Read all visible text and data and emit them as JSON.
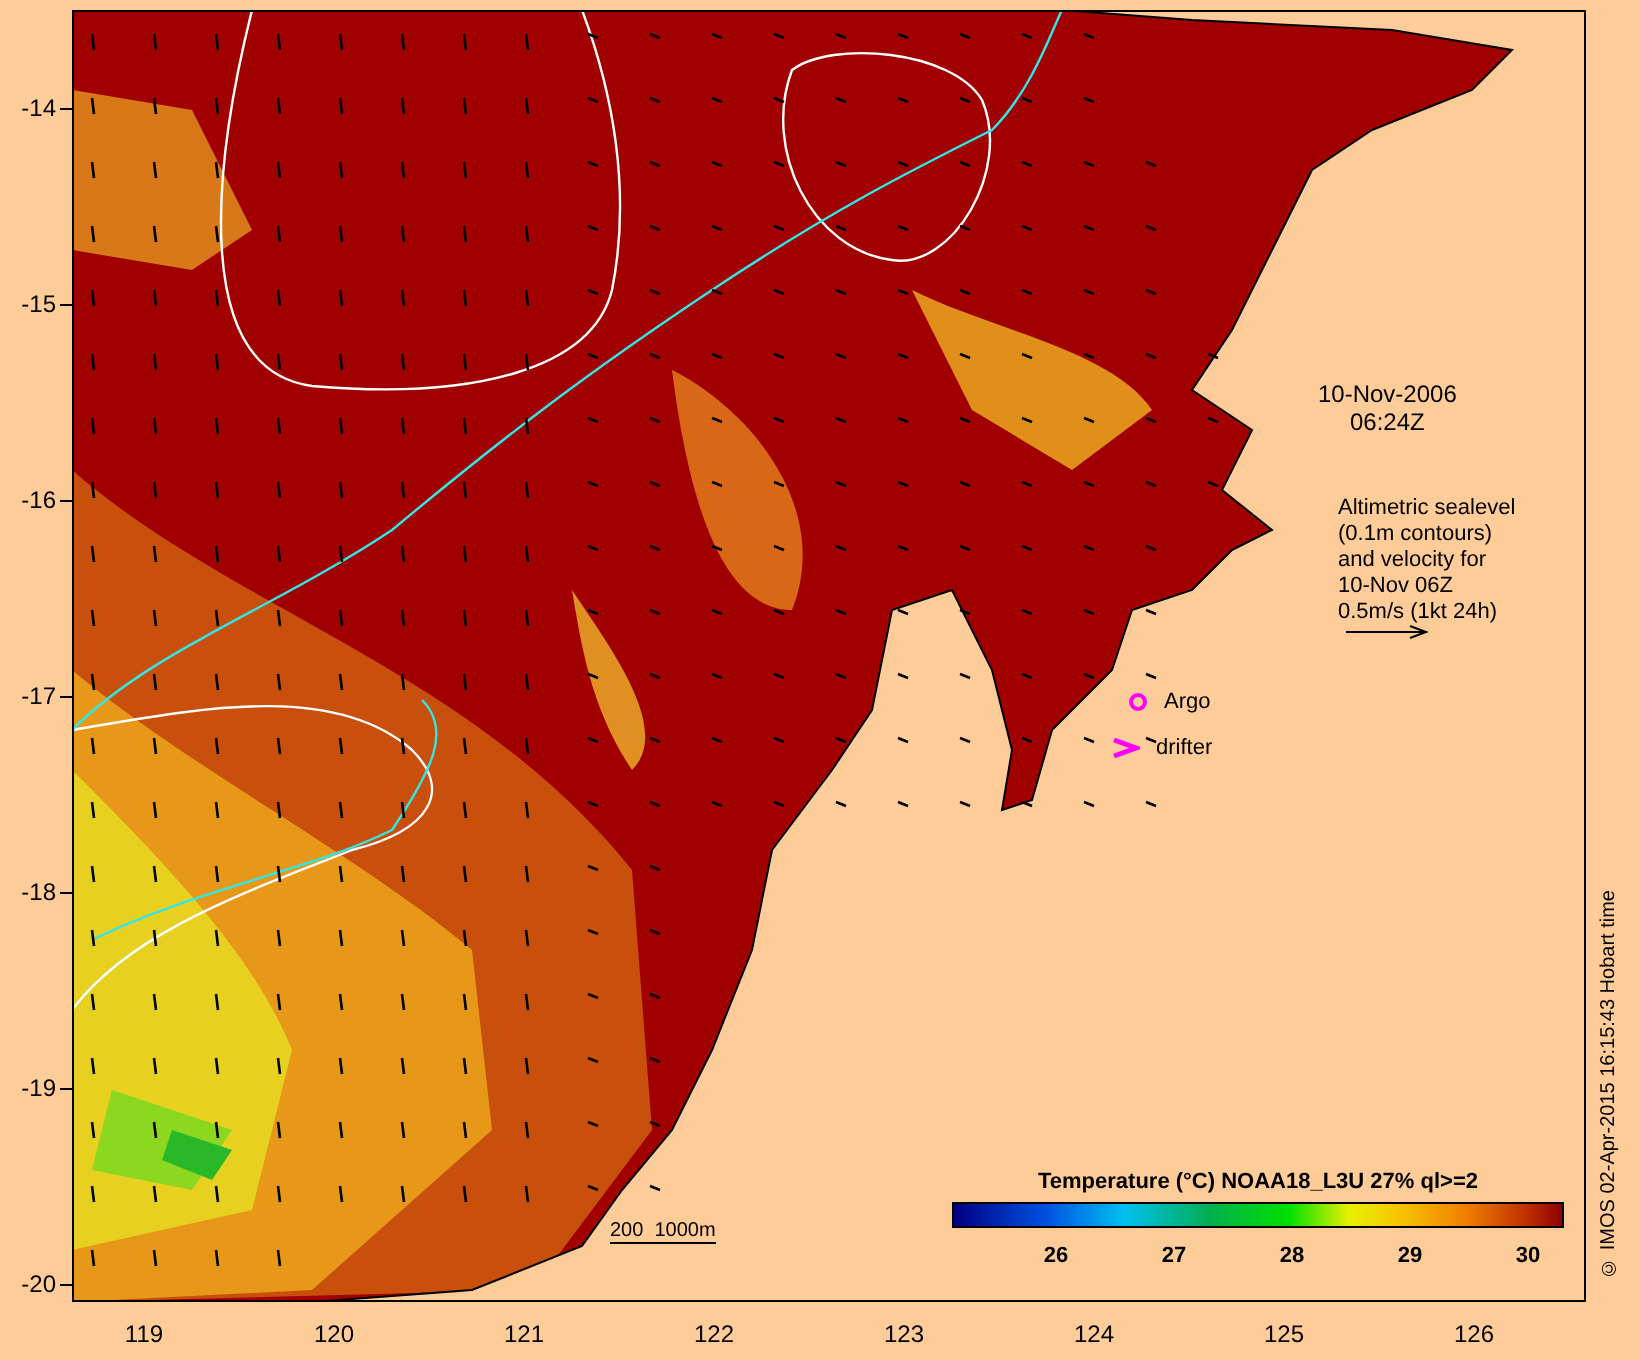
{
  "map": {
    "date": "10-Nov-2006",
    "time": "06:24Z",
    "legend_lines": [
      "Altimetric sealevel",
      "(0.1m contours)",
      "and velocity for",
      "10-Nov 06Z",
      "0.5m/s (1kt 24h)"
    ],
    "markers": [
      {
        "kind": "argo",
        "label": "Argo"
      },
      {
        "kind": "drifter",
        "label": "drifter"
      }
    ],
    "scale_label": "200  1000m",
    "colorbar": {
      "title": "Temperature (°C) NOAA18_L3U 27% ql>=2",
      "ticks": [
        "26",
        "27",
        "28",
        "29",
        "30"
      ]
    }
  },
  "y_axis": {
    "ticks": [
      "-14",
      "-15",
      "-16",
      "-17",
      "-18",
      "-19",
      "-20"
    ]
  },
  "x_axis": {
    "ticks": [
      "119",
      "120",
      "121",
      "122",
      "123",
      "124",
      "125",
      "126"
    ]
  },
  "credit": "© IMOS 02-Apr-2015 16:15:43 Hobart time"
}
